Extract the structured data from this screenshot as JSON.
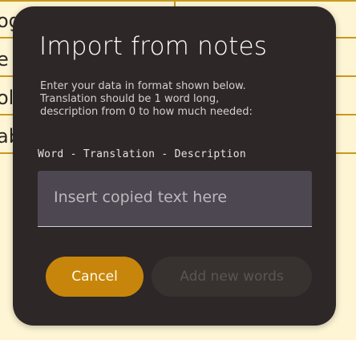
{
  "background": {
    "cells": [
      "og",
      "e",
      "ol",
      "ab"
    ]
  },
  "modal": {
    "title": "Import from notes",
    "description_lines": [
      "Enter your data in format shown below.",
      "Translation should be 1 word long,",
      "description from 0 to how much needed:"
    ],
    "format_example": "Word - Translation - Description",
    "input": {
      "placeholder": "Insert copied text here",
      "value": ""
    },
    "buttons": {
      "cancel_label": "Cancel",
      "add_label": "Add new words"
    }
  },
  "colors": {
    "page_background": "#fdf5d4",
    "table_lines": "#c89a1c",
    "modal_background": "#2d2827",
    "input_background": "#4c4750",
    "cancel_button": "#c7860b",
    "add_button_disabled": "#37322f"
  }
}
